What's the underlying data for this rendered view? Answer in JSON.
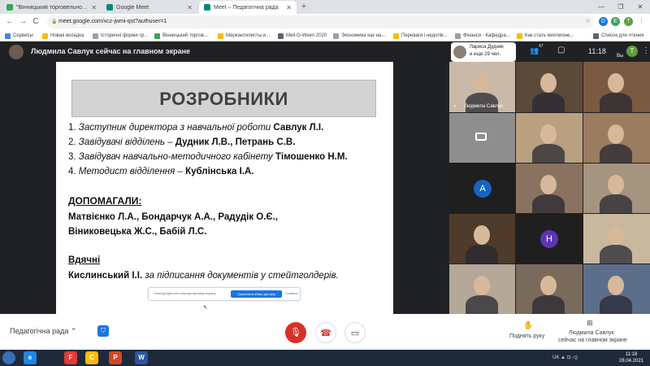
{
  "browser": {
    "tabs": [
      {
        "title": "\"Вінницький торговельно-економ...",
        "active": false
      },
      {
        "title": "Google Meet",
        "active": false
      },
      {
        "title": "Meet – Педагогічна рада",
        "active": true
      }
    ],
    "new_tab": "+",
    "win_min": "—",
    "win_max": "❐",
    "win_close": "✕",
    "url": "meet.google.com/xcz-jwmi-qst?authuser=1",
    "back": "←",
    "forward": "→",
    "reload": "C"
  },
  "bookmarks": [
    {
      "label": "Сервисы",
      "color": "#4285f4"
    },
    {
      "label": "Новая вкладка",
      "color": "#fbbc04"
    },
    {
      "label": "Історичні форми гр...",
      "color": "#9aa0a6"
    },
    {
      "label": "Вінницький торгов...",
      "color": "#34a853"
    },
    {
      "label": "Меркантилисты и...",
      "color": "#fbbc04"
    },
    {
      "label": "Mell-O-Ween 2020",
      "color": "#5f6368"
    },
    {
      "label": "Экономика как на...",
      "color": "#9aa0a6"
    },
    {
      "label": "Переваги і недолік...",
      "color": "#fbbc04"
    },
    {
      "label": "Фінанси - Кафедра...",
      "color": "#9aa0a6"
    },
    {
      "label": "Как стать миллионе...",
      "color": "#fbbc04"
    },
    {
      "label": "Список для чтения",
      "color": "#5f6368"
    }
  ],
  "meet": {
    "presenter_text": "Людмила Савлук сейчас на главном экране",
    "you_name": "Лариса Дудник",
    "you_more": "и еще 29 чел.",
    "people_count": "47",
    "time": "11:18",
    "user_initial": "T",
    "you_label": "Вы"
  },
  "slide": {
    "title": "РОЗРОБНИКИ",
    "developers": [
      {
        "n": "1.",
        "role": "Заступник директора з навчальної роботи",
        "sep": " ",
        "who": "Савлук Л.І."
      },
      {
        "n": "2.",
        "role": "Завідувачі відділень –",
        "sep": " ",
        "who": "Дудник Л.В., Петрань С.В."
      },
      {
        "n": "3.",
        "role": "Завідувач навчально-методичного кабінету",
        "sep": " ",
        "who": "Тімошенко Н.М."
      },
      {
        "n": "4.",
        "role": "Методист відділення –",
        "sep": " ",
        "who": "Кублінська І.А."
      }
    ],
    "helped_heading": "ДОПОМАГАЛИ:",
    "helped_lines": [
      "Матвієнко Л.А., Бондарчук А.А., Радудік О.Є.,",
      "Віниковецька Ж.С., Бабій Л.С."
    ],
    "thanks_heading": "Вдячні",
    "thanks_who": "Кислинський І.І.",
    "thanks_what": " за підписання документів у стейтголдерів.",
    "share_msg": "meet.google.com показує вашому екрану.",
    "share_stop": "Припинити обмін доступу",
    "share_hide": "Сховати"
  },
  "tiles": [
    {
      "name": "Людмила Савлук",
      "bg": "#c9b9a8",
      "kind": "person"
    },
    {
      "name": "",
      "bg": "#5b4a3a",
      "kind": "person"
    },
    {
      "name": "",
      "bg": "#7a5a40",
      "kind": "person"
    },
    {
      "name": "",
      "bg": "#8e8e8e",
      "kind": "camoff"
    },
    {
      "name": "",
      "bg": "#b8a080",
      "kind": "person"
    },
    {
      "name": "",
      "bg": "#9a7c5e",
      "kind": "person"
    },
    {
      "name": "",
      "bg": "#1f1f1f",
      "kind": "letter",
      "letter": "A",
      "color": "#1565c0"
    },
    {
      "name": "",
      "bg": "#8a7260",
      "kind": "person"
    },
    {
      "name": "",
      "bg": "#a59480",
      "kind": "person"
    },
    {
      "name": "",
      "bg": "#4e3b2c",
      "kind": "person"
    },
    {
      "name": "",
      "bg": "#1f1f1f",
      "kind": "letter",
      "letter": "H",
      "color": "#5e35b1"
    },
    {
      "name": "",
      "bg": "#c8b89e",
      "kind": "person"
    },
    {
      "name": "",
      "bg": "#b5a898",
      "kind": "person"
    },
    {
      "name": "",
      "bg": "#7a6a5c",
      "kind": "person"
    },
    {
      "name": "",
      "bg": "#5c6f8a",
      "kind": "person"
    }
  ],
  "controls": {
    "meeting_name": "Педагогічна рада",
    "meeting_caret": "⌃",
    "shield": "⛉",
    "mic": "🎙",
    "hangup": "☎",
    "camera": "▭",
    "raise_icon": "✋",
    "raise_label": "Поднять руку",
    "present_icon": "⊞",
    "present_l1": "Людмила Савлук",
    "present_l2": "сейчас на главном экране"
  },
  "taskbar": {
    "apps": [
      {
        "label": "e",
        "color": "#1e88e5"
      },
      {
        "label": "F",
        "color": "#e53935"
      },
      {
        "label": "C",
        "color": "#fbbc04"
      },
      {
        "label": "P",
        "color": "#d24726"
      },
      {
        "label": "W",
        "color": "#2b579a"
      }
    ],
    "tray": "UK ▲ ⊡ ◁)",
    "time": "11:18",
    "date": "28.04.2021"
  }
}
